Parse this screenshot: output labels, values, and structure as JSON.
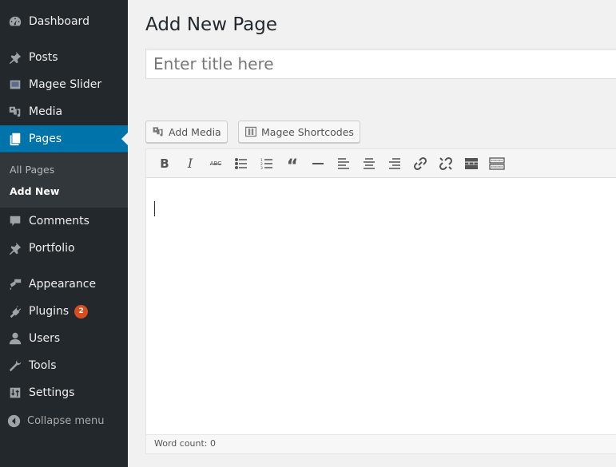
{
  "sidebar": {
    "items": [
      {
        "label": "Dashboard",
        "icon": "dashboard-icon"
      },
      {
        "label": "Posts",
        "icon": "pin-icon"
      },
      {
        "label": "Magee Slider",
        "icon": "slider-icon"
      },
      {
        "label": "Media",
        "icon": "media-icon"
      },
      {
        "label": "Pages",
        "icon": "pages-icon",
        "active": true
      },
      {
        "label": "Comments",
        "icon": "comment-icon"
      },
      {
        "label": "Portfolio",
        "icon": "pin-icon"
      },
      {
        "label": "Appearance",
        "icon": "brush-icon"
      },
      {
        "label": "Plugins",
        "icon": "plugin-icon",
        "badge": "2"
      },
      {
        "label": "Users",
        "icon": "user-icon"
      },
      {
        "label": "Tools",
        "icon": "wrench-icon"
      },
      {
        "label": "Settings",
        "icon": "settings-icon"
      }
    ],
    "submenu": [
      "All Pages",
      "Add New"
    ],
    "collapse_label": "Collapse menu"
  },
  "main": {
    "page_title": "Add New Page",
    "title_placeholder": "Enter title here",
    "add_media_label": "Add Media",
    "shortcodes_label": "Magee Shortcodes",
    "toolbar": [
      "bold",
      "italic",
      "strikethrough",
      "bullet-list",
      "numbered-list",
      "blockquote",
      "horizontal-rule",
      "align-left",
      "align-center",
      "align-right",
      "insert-link",
      "remove-link",
      "read-more",
      "toolbar-toggle"
    ],
    "word_count": "Word count: 0"
  },
  "colors": {
    "sidebar_bg": "#23282d",
    "active_bg": "#0073aa",
    "badge": "#d54e21"
  }
}
